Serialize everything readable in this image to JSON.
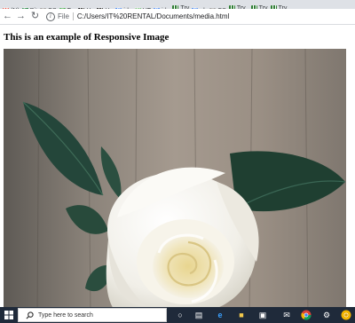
{
  "bookmarks": [
    {
      "icon": "gmail-icon",
      "label": "(N)",
      "color": "#ea4335",
      "glyph": "M"
    },
    {
      "icon": "sheets-icon",
      "label": "Bit",
      "color": "#188038",
      "glyph": "E"
    },
    {
      "icon": "bookmark-icon",
      "label": "CS",
      "color": "#9e9e9e",
      "glyph": "■"
    },
    {
      "icon": "bookmark-icon",
      "label": "Try",
      "color": "#4caf50",
      "glyph": "■"
    },
    {
      "icon": "hackerrank-icon",
      "label": "Ho",
      "color": "#212121",
      "glyph": "H"
    },
    {
      "icon": "hackerrank-icon",
      "label": "Ho",
      "color": "#212121",
      "glyph": "H"
    },
    {
      "icon": "google-icon",
      "label": "ide",
      "color": "#4285f4",
      "glyph": "G"
    },
    {
      "icon": "w3schools-icon",
      "label": "HT",
      "color": "#4caf50",
      "glyph": "W"
    },
    {
      "icon": "google-icon",
      "label": "ide",
      "color": "#4285f4",
      "glyph": "G"
    },
    {
      "icon": "bars-icon",
      "label": "Try",
      "color": "#2e7d32",
      "glyph": ""
    },
    {
      "icon": "google-icon",
      "label": "ab",
      "color": "#4285f4",
      "glyph": "G"
    },
    {
      "icon": "bookmark-icon",
      "label": "CS",
      "color": "#9e9e9e",
      "glyph": "■"
    },
    {
      "icon": "bars-icon",
      "label": "Try",
      "color": "#2e7d32",
      "glyph": ""
    },
    {
      "icon": "photo-icon",
      "label": "",
      "color": "#8d6e63",
      "glyph": ""
    },
    {
      "icon": "bars-icon",
      "label": "Try",
      "color": "#2e7d32",
      "glyph": ""
    },
    {
      "icon": "bars-icon",
      "label": "Try",
      "color": "#2e7d32",
      "glyph": ""
    }
  ],
  "navbar": {
    "back_icon": "←",
    "forward_icon": "→",
    "reload_icon": "↻",
    "scheme": "File",
    "url": "C:/Users/IT%20RENTAL/Documents/media.html"
  },
  "page": {
    "heading": "This is an example of Responsive Image",
    "image_alt": "white-rose-photo"
  },
  "taskbar": {
    "search_placeholder": "Type here to search",
    "icons": [
      "cortana-icon",
      "task-view-icon",
      "edge-icon",
      "file-explorer-icon",
      "store-icon",
      "dropbox-icon",
      "mail-icon",
      "chrome-icon",
      "settings-icon",
      "chrome-canary-icon"
    ]
  },
  "colors": {
    "taskbar": "#1f2a3a",
    "rose_petal": "#f4f2ea",
    "leaf": "#244534",
    "background_wood": "#8e857a"
  }
}
